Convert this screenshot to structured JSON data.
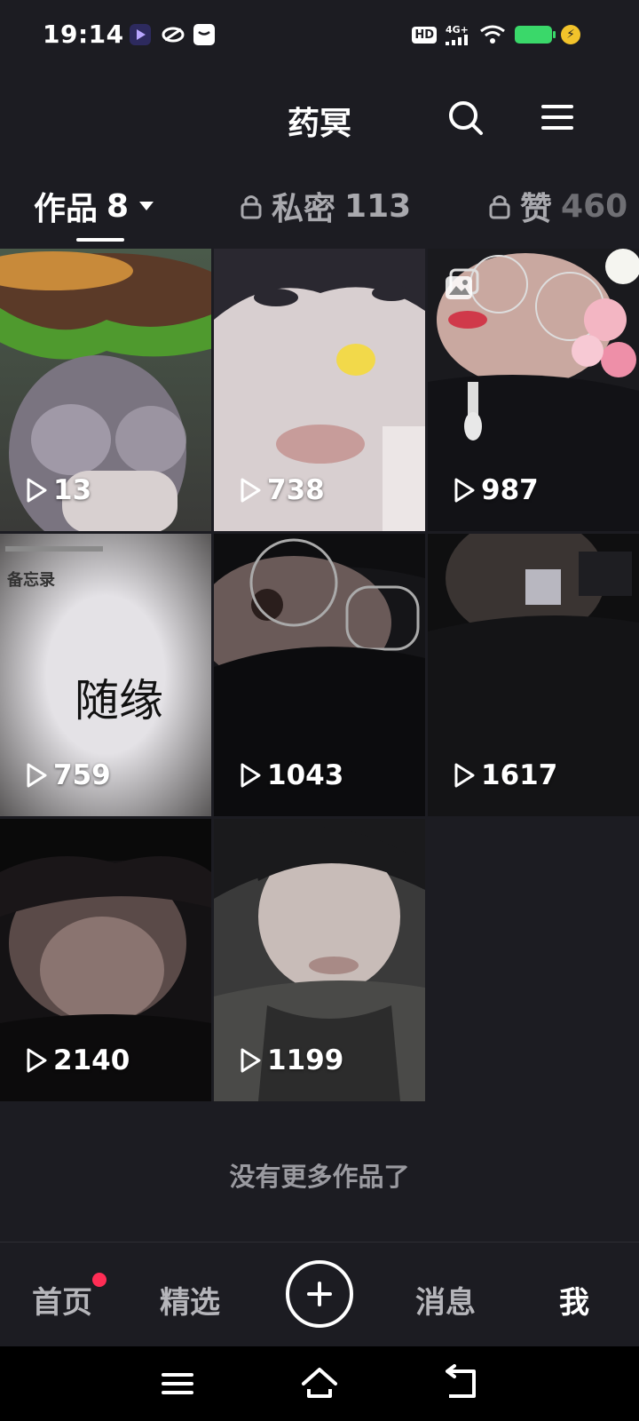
{
  "status_bar": {
    "time": "19:14",
    "hd": "HD",
    "network": "4G+",
    "icons": [
      "video-app-icon",
      "browser-app-icon",
      "message-app-icon",
      "signal-icon",
      "wifi-icon",
      "battery-icon",
      "charging-icon"
    ]
  },
  "header": {
    "title": "药冥",
    "icons": [
      "search-icon",
      "menu-icon"
    ]
  },
  "tabs": [
    {
      "label": "作品",
      "count": "8",
      "active": true,
      "locked": false
    },
    {
      "label": "私密",
      "count": "113",
      "active": false,
      "locked": true
    },
    {
      "label": "赞",
      "count": "460",
      "active": false,
      "locked": true
    }
  ],
  "videos": [
    {
      "views": "13",
      "image": "selfie-with-burger-overlay"
    },
    {
      "views": "738",
      "image": "selfie-closeup"
    },
    {
      "views": "987",
      "image": "selfie-with-flowers",
      "type": "image-post"
    },
    {
      "views": "759",
      "image": "memo-note",
      "memo_header": "备忘录",
      "memo_text": "随缘"
    },
    {
      "views": "1043",
      "image": "glasses-closeup"
    },
    {
      "views": "1617",
      "image": "dark-selfie"
    },
    {
      "views": "2140",
      "image": "dark-selfie-hand"
    },
    {
      "views": "1199",
      "image": "selfie-hooded"
    }
  ],
  "footer_text": "没有更多作品了",
  "bottom_nav": {
    "home": "首页",
    "featured": "精选",
    "messages": "消息",
    "me": "我"
  },
  "colors": {
    "background": "#1c1c22",
    "accent_dot": "#ff2d55",
    "battery": "#3ad86a"
  }
}
